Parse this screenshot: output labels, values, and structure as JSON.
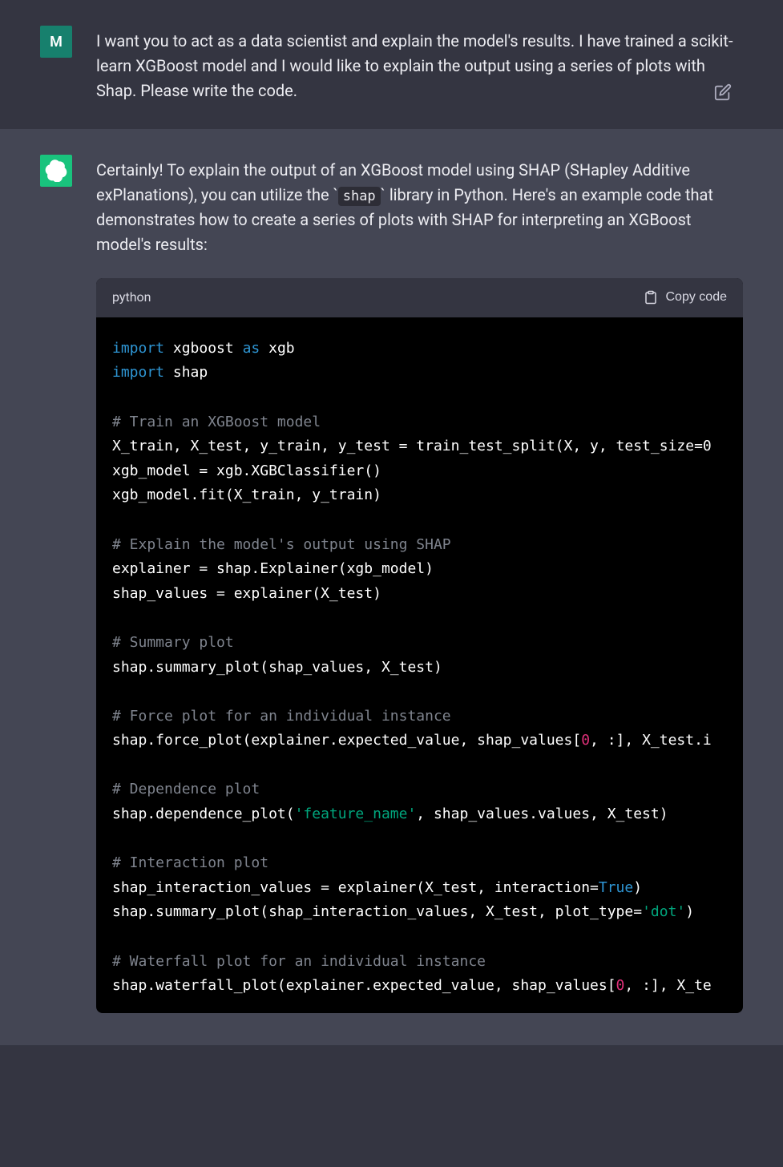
{
  "user": {
    "avatar_letter": "M",
    "message": "I want you to act as a data scientist and explain the model's results. I have trained a scikit-learn XGBoost model and I would like to explain the output using a series of plots with Shap. Please write the code."
  },
  "assistant": {
    "intro_part1": "Certainly! To explain the output of an XGBoost model using SHAP (SHapley Additive exPlanations), you can utilize the ",
    "intro_code": "shap",
    "intro_part2": " library in Python. Here's an example code that demonstrates how to create a series of plots with SHAP for interpreting an XGBoost model's results:"
  },
  "codeblock": {
    "language": "python",
    "copy_label": "Copy code",
    "lines": {
      "l1_kw1": "import",
      "l1_t1": " xgboost ",
      "l1_kw2": "as",
      "l1_t2": " xgb",
      "l2_kw1": "import",
      "l2_t1": " shap",
      "l3_cm": "# Train an XGBoost model",
      "l4": "X_train, X_test, y_train, y_test = train_test_split(X, y, test_size=0",
      "l5": "xgb_model = xgb.XGBClassifier()",
      "l6": "xgb_model.fit(X_train, y_train)",
      "l7_cm": "# Explain the model's output using SHAP",
      "l8": "explainer = shap.Explainer(xgb_model)",
      "l9": "shap_values = explainer(X_test)",
      "l10_cm": "# Summary plot",
      "l11": "shap.summary_plot(shap_values, X_test)",
      "l12_cm": "# Force plot for an individual instance",
      "l13_a": "shap.force_plot(explainer.expected_value, shap_values[",
      "l13_num": "0",
      "l13_b": ", :], X_test.i",
      "l14_cm": "# Dependence plot",
      "l15_a": "shap.dependence_plot(",
      "l15_str": "'feature_name'",
      "l15_b": ", shap_values.values, X_test)",
      "l16_cm": "# Interaction plot",
      "l17_a": "shap_interaction_values = explainer(X_test, interaction=",
      "l17_bool": "True",
      "l17_b": ")",
      "l18_a": "shap.summary_plot(shap_interaction_values, X_test, plot_type=",
      "l18_str": "'dot'",
      "l18_b": ")",
      "l19_cm": "# Waterfall plot for an individual instance",
      "l20_a": "shap.waterfall_plot(explainer.expected_value, shap_values[",
      "l20_num": "0",
      "l20_b": ", :], X_te"
    }
  }
}
